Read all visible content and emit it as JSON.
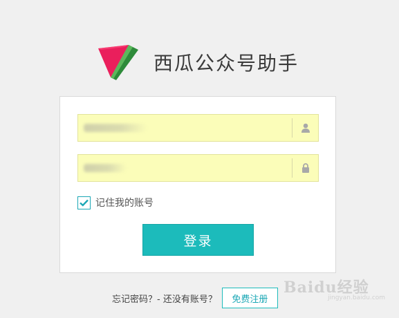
{
  "header": {
    "title": "西瓜公众号助手",
    "logo_icon": "watermelon-slice-logo"
  },
  "colors": {
    "background": "#f0f0f0",
    "field_bg": "#fbfdb9",
    "accent": "#1cbbbb",
    "logo_red": "#e91e5a",
    "logo_green": "#3a9a3a"
  },
  "login_form": {
    "username": {
      "value": "",
      "icon": "user-icon",
      "redacted": true
    },
    "password": {
      "value": "",
      "icon": "lock-icon",
      "redacted": true
    },
    "remember": {
      "label": "记住我的账号",
      "checked": true
    },
    "submit_label": "登录"
  },
  "footer": {
    "prompt_text": "忘记密码？- 还没有账号？",
    "register_label": "免费注册"
  },
  "watermark": {
    "text": "Baidu经验",
    "subtext": "jingyan.baidu.com"
  }
}
